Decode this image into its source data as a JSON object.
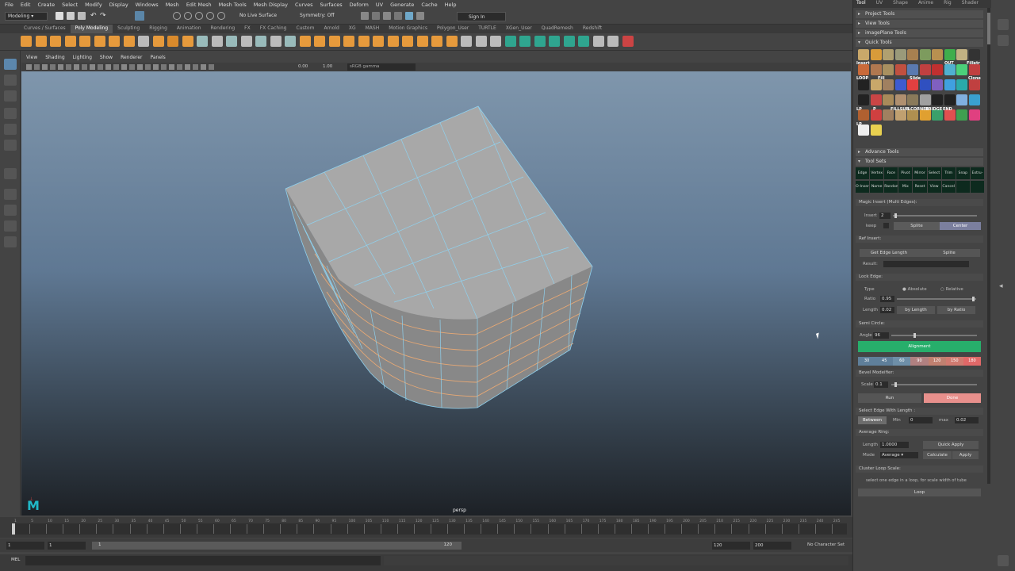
{
  "menubar": [
    "File",
    "Edit",
    "Create",
    "Select",
    "Modify",
    "Display",
    "Windows",
    "Mesh",
    "Edit Mesh",
    "Mesh Tools",
    "Mesh Display",
    "Curves",
    "Surfaces",
    "Deform",
    "UV",
    "Generate",
    "Cache",
    "Help"
  ],
  "status": {
    "mode": "Modeling",
    "live_surface": "No Live Surface",
    "symmetry": "Symmetry: Off",
    "sign_in": "Sign In"
  },
  "shelf_tabs": [
    "Curves / Surfaces",
    "Poly Modeling",
    "Sculpting",
    "Rigging",
    "Animation",
    "Rendering",
    "FX",
    "FX Caching",
    "Custom",
    "Arnold",
    "XG",
    "MASH",
    "Motion Graphics",
    "Polygon_User",
    "TURTLE",
    "XGen_User",
    "QuadRemesh",
    "Redshift"
  ],
  "shelf_active": "Poly Modeling",
  "panel_menu": [
    "View",
    "Shading",
    "Lighting",
    "Show",
    "Renderer",
    "Panels"
  ],
  "panel_toolbar": {
    "val1": "0.00",
    "val2": "1.00",
    "colorspace": "sRGB gamma"
  },
  "viewport": {
    "camera": "persp",
    "logo": "M"
  },
  "timeline": {
    "ticks": [
      "1",
      "5",
      "10",
      "15",
      "20",
      "25",
      "30",
      "35",
      "40",
      "45",
      "50",
      "55",
      "60",
      "65",
      "70",
      "75",
      "80",
      "85",
      "90",
      "95",
      "100",
      "105",
      "110",
      "115",
      "120",
      "125",
      "130",
      "135",
      "140",
      "145",
      "150",
      "155",
      "160",
      "165",
      "170",
      "175",
      "180",
      "185",
      "190",
      "195",
      "200",
      "205",
      "210",
      "215",
      "220",
      "225",
      "230",
      "235",
      "240",
      "245"
    ]
  },
  "range": {
    "start": "1",
    "start2": "1",
    "slider_start": "1",
    "slider_end": "120",
    "end": "120",
    "end2": "200",
    "character": "No Character Set"
  },
  "cmd": {
    "label": "MEL"
  },
  "right_tabs": [
    "Tool",
    "UV",
    "Shape",
    "Anime",
    "Rig",
    "Shader"
  ],
  "right_tab_active": "Tool",
  "sections": {
    "project_tools": "Project Tools",
    "view_tools": "View Tools",
    "image_plane": "imagePlane Tools",
    "quick_tools": "Quick Tools",
    "advance_tools": "Advance Tools",
    "tool_sets": "Tool Sets"
  },
  "quick_labels": [
    "Insert",
    "OUT",
    "Filletr",
    "LOOP",
    "Fill",
    "Slide",
    "Clone",
    "LP",
    "P",
    "FILLSUB",
    "LCORNER",
    "BRIDGE",
    "END",
    "LP"
  ],
  "toolset_row1": [
    "Edge",
    "Vertex",
    "Face",
    "Pivot",
    "Mirror",
    "Select",
    "Trim",
    "Snap",
    "Extru-"
  ],
  "toolset_row2": [
    "O-Inser",
    "Name",
    "Random",
    "Mix",
    "Reset",
    "View",
    "Cancel"
  ],
  "magic_insert": {
    "title": "Magic Insert (Multi Edges):",
    "insert_label": "Insert",
    "insert_value": "2",
    "keep_label": "keep",
    "splite": "Splite",
    "center": "Center"
  },
  "ref_insert": {
    "title": "Ref Insert:",
    "get_edge": "Get Edge Length",
    "splite": "Splite",
    "result_label": "Result:"
  },
  "lock_edge": {
    "title": "Lock Edge:",
    "type_label": "Type",
    "absolute": "Absolute",
    "relative": "Relative",
    "ratio_label": "Ratio",
    "ratio_value": "0.95",
    "length_label": "Length",
    "length_value": "0.02",
    "by_length": "by Length",
    "by_ratio": "by Ratio"
  },
  "semi_circle": {
    "title": "Semi Circle:",
    "angle_label": "Angle",
    "angle_value": "96",
    "alignment": "Alignment",
    "angles": [
      "30",
      "45",
      "60",
      "90",
      "120",
      "150",
      "180"
    ]
  },
  "bevel": {
    "title": "Bevel Modeifier:",
    "scale_label": "Scale",
    "scale_value": "0.1",
    "run": "Run",
    "done": "Done"
  },
  "select_edge": {
    "title": "Select Edge With Length :",
    "between": "Between",
    "min_label": "Min",
    "min_value": "0",
    "max_label": "max",
    "max_value": "0.02"
  },
  "average_ring": {
    "title": "Average Ring:",
    "length_label": "Length",
    "length_value": "1.0000",
    "quick_apply": "Quick Apply",
    "mode_label": "Mode",
    "mode_value": "Average",
    "calculate": "Calculate",
    "apply": "Apply"
  },
  "cluster_loop": {
    "title": "Cluster Loop Scale:",
    "hint": "select one edge in a loop, for scale width of tube",
    "loop": "Loop"
  },
  "colors": {
    "alignment": "#27ae6b",
    "done": "#e8908c",
    "selected_edges": "#e7a874",
    "wire": "#8fd1ee",
    "mesh": "#a8a8a8"
  }
}
